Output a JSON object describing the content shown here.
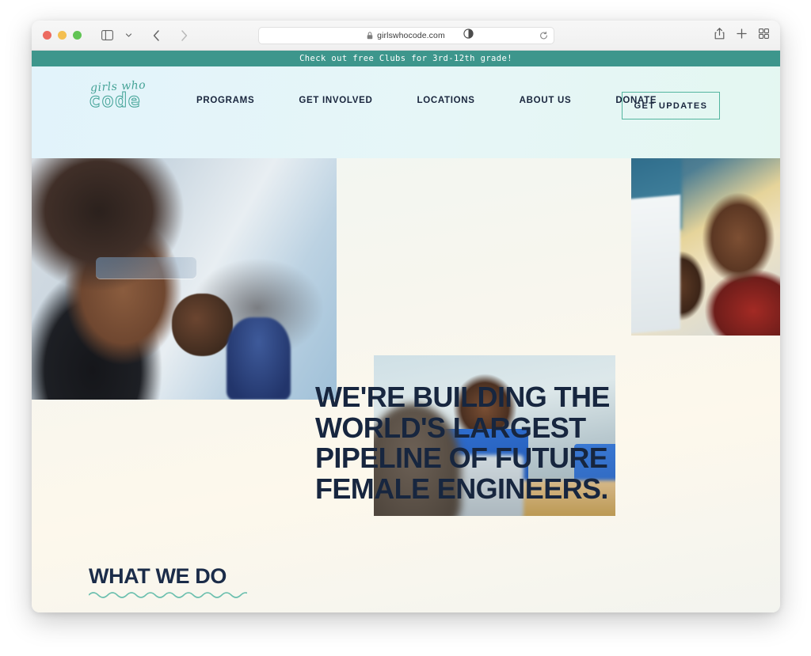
{
  "browser": {
    "url": "girlswhocode.com",
    "lock_icon": "lock-icon",
    "reload_icon": "reload-icon",
    "sidebar_icon": "sidebar-icon",
    "chevron_icon": "chevron-down-icon",
    "back_icon": "back-arrow-icon",
    "forward_icon": "forward-arrow-icon",
    "contrast_icon": "contrast-icon",
    "share_icon": "share-icon",
    "new_tab_icon": "plus-icon",
    "tabs_icon": "tab-overview-icon"
  },
  "announcement": {
    "text": "Check out free Clubs for 3rd-12th grade!",
    "background": "#3d968c"
  },
  "logo": {
    "script_text": "girls who",
    "block_text": "code",
    "color": "#3ea194"
  },
  "nav": {
    "items": [
      {
        "label": "PROGRAMS"
      },
      {
        "label": "GET INVOLVED"
      },
      {
        "label": "LOCATIONS"
      },
      {
        "label": "ABOUT US"
      },
      {
        "label": "DONATE"
      }
    ],
    "cta": {
      "label": "GET UPDATES",
      "border_color": "#53b59f"
    }
  },
  "hero": {
    "headline_lines": [
      "WE'RE BUILDING THE",
      "WORLD'S LARGEST",
      "PIPELINE OF FUTURE",
      "FEMALE ENGINEERS."
    ],
    "headline_color": "#17263f",
    "images": [
      {
        "name": "hero-photo-left",
        "alt": "Smiling student with glasses in classroom"
      },
      {
        "name": "hero-photo-top-right",
        "alt": "Two students working together at a computer"
      },
      {
        "name": "hero-photo-center",
        "alt": "Student smiling behind blue laptops"
      }
    ]
  },
  "what_we_do": {
    "title": "WHAT WE DO",
    "underline_color": "#6bbfae"
  }
}
